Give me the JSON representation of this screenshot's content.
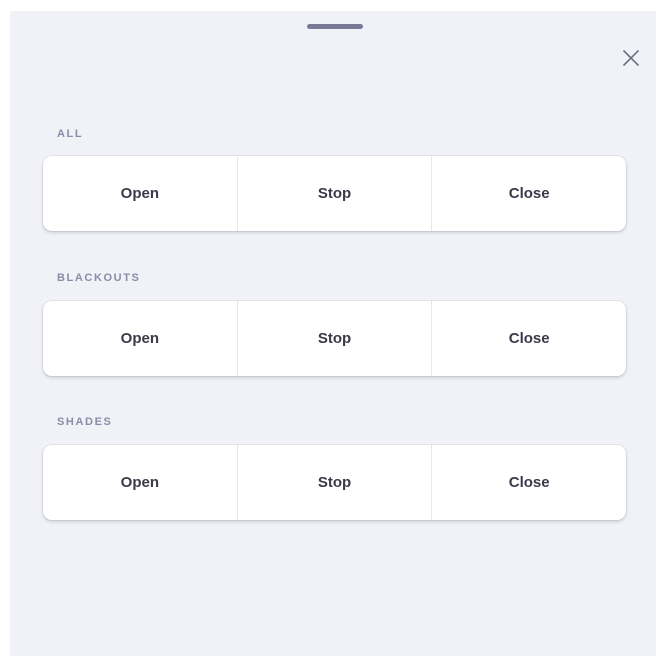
{
  "sheet": {
    "close_icon": "close-icon",
    "handle_icon": "drag-handle"
  },
  "groups": [
    {
      "label": "ALL",
      "buttons": [
        "Open",
        "Stop",
        "Close"
      ]
    },
    {
      "label": "BLACKOUTS",
      "buttons": [
        "Open",
        "Stop",
        "Close"
      ]
    },
    {
      "label": "SHADES",
      "buttons": [
        "Open",
        "Stop",
        "Close"
      ]
    }
  ],
  "colors": {
    "sheet_background": "#f1f2f8",
    "label": "#8d8ba8",
    "button_text": "#3a3a4a",
    "handle": "#7b7a94"
  }
}
